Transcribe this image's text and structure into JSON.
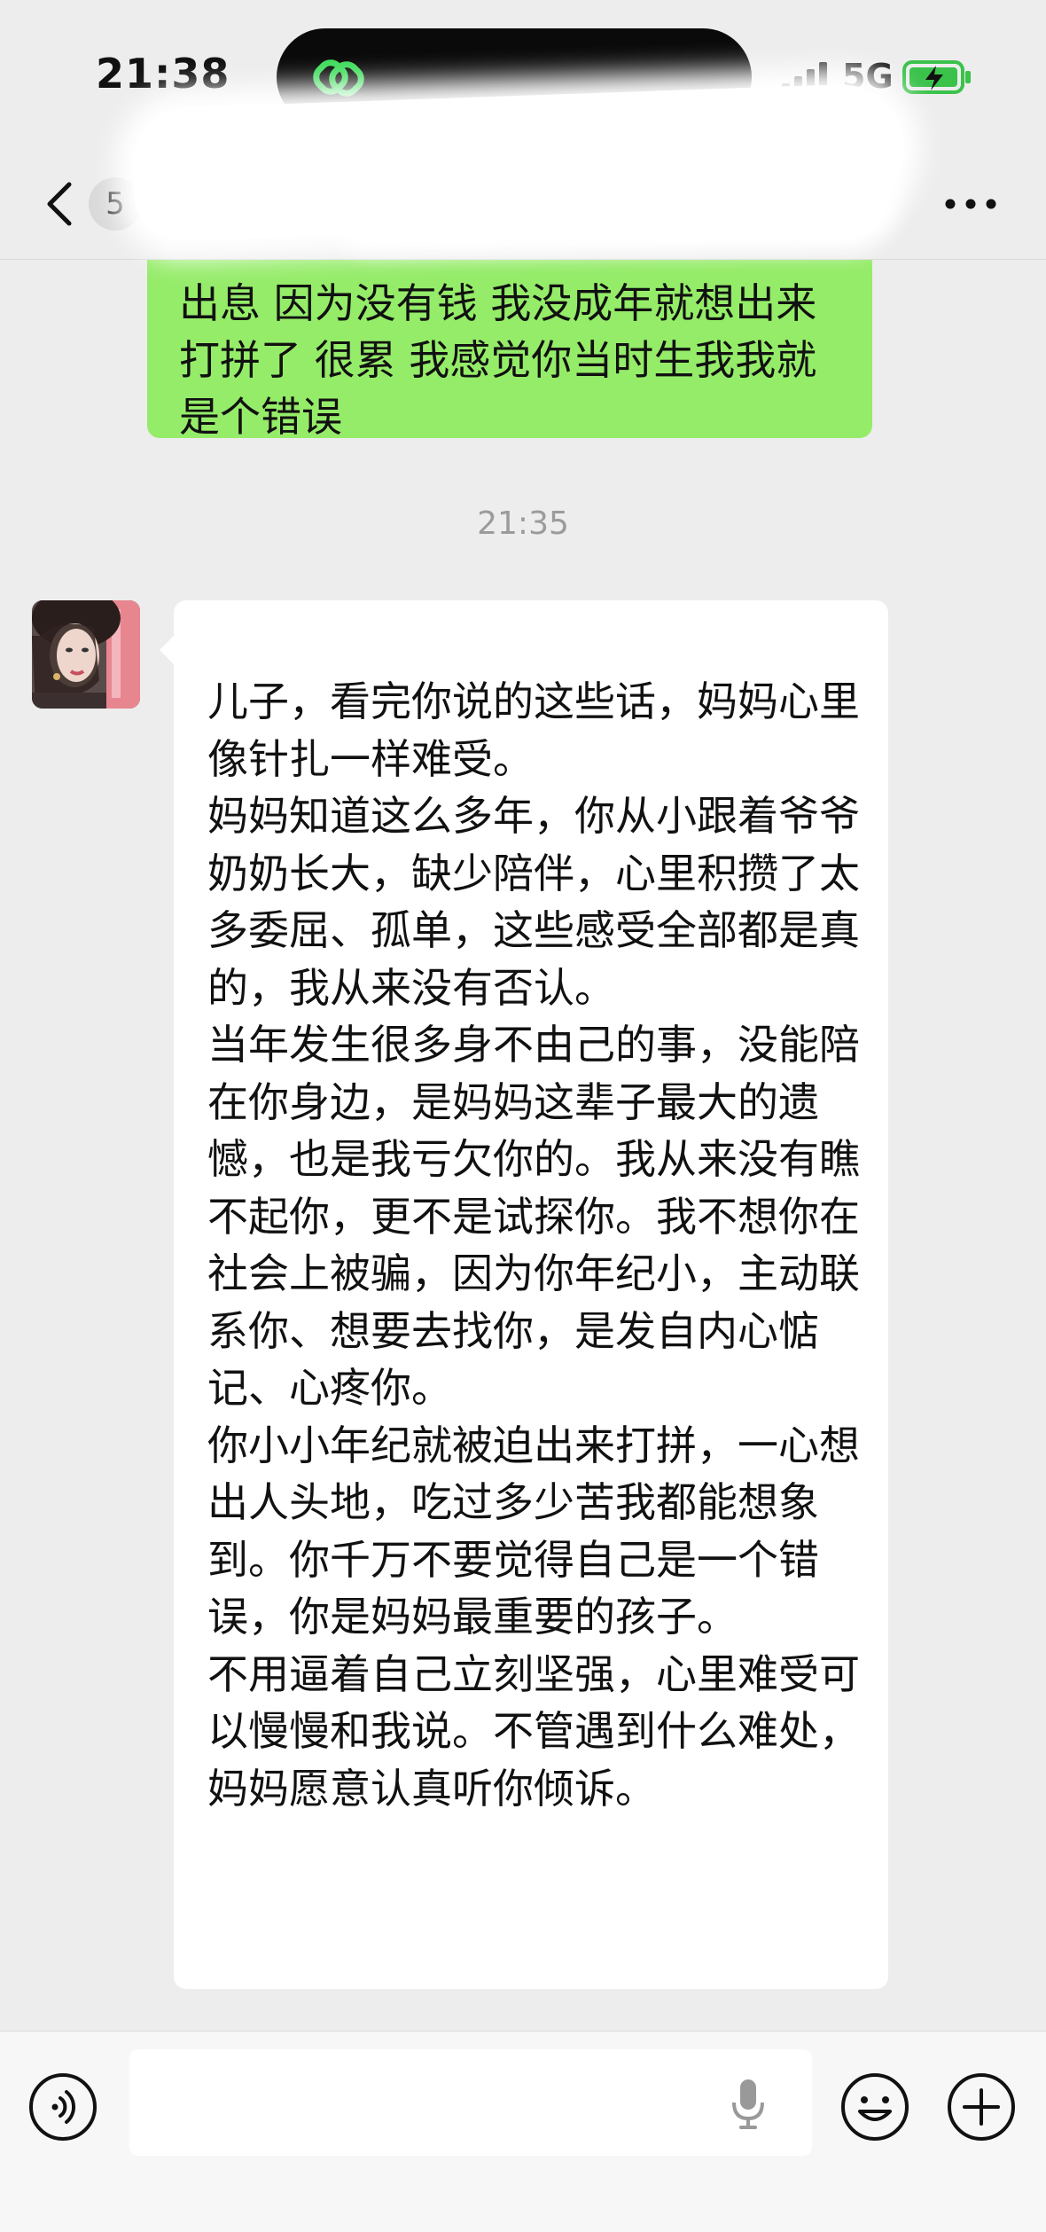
{
  "status_bar": {
    "time": "21:38",
    "network": "5G"
  },
  "nav": {
    "unread_count": "5",
    "title": ""
  },
  "messages": {
    "sent_text": "出息 因为没有钱 我没成年就想出来打拼了 很累 我感觉你当时生我我就是个错误",
    "timestamp": "21:35",
    "received_text": "儿子，看完你说的这些话，妈妈心里像针扎一样难受。\n妈妈知道这么多年，你从小跟着爷爷奶奶长大，缺少陪伴，心里积攒了太多委屈、孤单，这些感受全部都是真的，我从来没有否认。\n当年发生很多身不由己的事，没能陪在你身边，是妈妈这辈子最大的遗憾，也是我亏欠你的。我从来没有瞧不起你，更不是试探你。我不想你在社会上被骗，因为你年纪小，主动联系你、想要去找你，是发自内心惦记、心疼你。\n你小小年纪就被迫出来打拼，一心想出人头地，吃过多少苦我都能想象到。你千万不要觉得自己是一个错误，你是妈妈最重要的孩子。\n不用逼着自己立刻坚强，心里难受可以慢慢和我说。不管遇到什么难处，妈妈愿意认真听你倾诉。"
  },
  "input": {
    "placeholder": ""
  },
  "colors": {
    "sent_bubble": "#95ec69",
    "received_bubble": "#ffffff",
    "background": "#ededed"
  },
  "icons": {
    "island": "link-icon",
    "voice": "voice-icon",
    "mic": "mic-icon",
    "emoji": "emoji-icon",
    "plus": "plus-icon",
    "back": "chevron-left-icon",
    "more": "more-icon"
  }
}
